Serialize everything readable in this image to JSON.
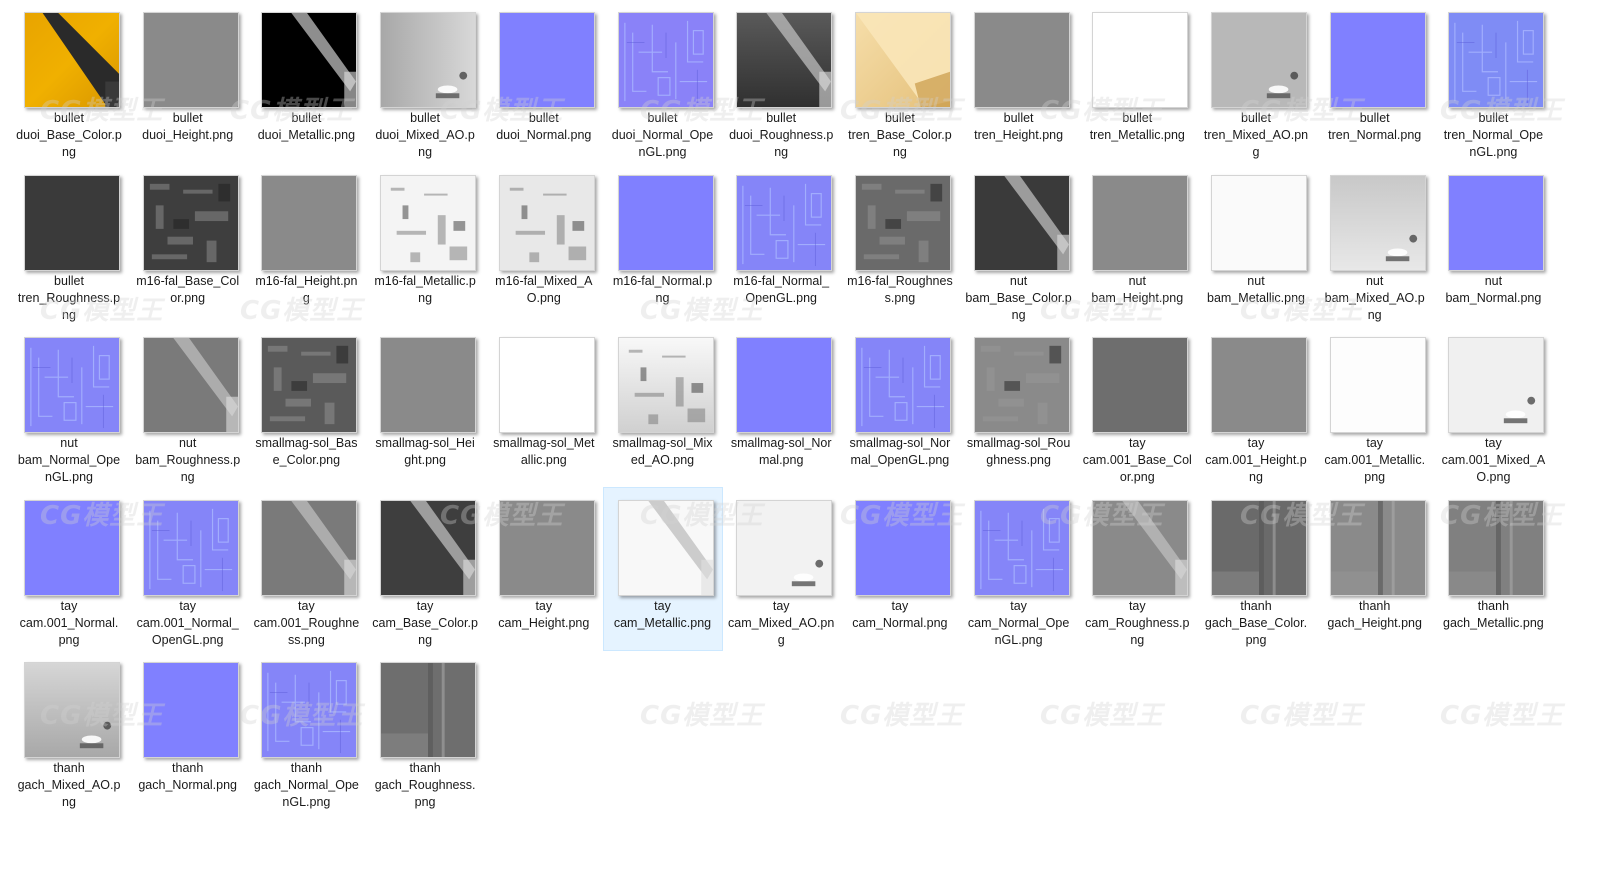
{
  "watermark_text": "CG模型王",
  "selected_file": "tay cam_Metallic.png",
  "files": [
    {
      "label": "bullet\nduoi_Base_Color.p\nng",
      "bg": "linear-gradient(135deg,#e8a400 0%,#f0b000 50%,#d89600 100%)",
      "detail": "dark-wedge"
    },
    {
      "label": "bullet\nduoi_Height.png",
      "bg": "#8a8a8a",
      "detail": "none"
    },
    {
      "label": "bullet\nduoi_Metallic.png",
      "bg": "#000000",
      "detail": "light-wedge"
    },
    {
      "label": "bullet\nduoi_Mixed_AO.p\nng",
      "bg": "linear-gradient(90deg,#a8a8a8,#d8d8d8)",
      "detail": "spot"
    },
    {
      "label": "bullet\nduoi_Normal.png",
      "bg": "#8080ff",
      "detail": "none"
    },
    {
      "label": "bullet\nduoi_Normal_Ope\nnGL.png",
      "bg": "#8a82f8",
      "detail": "normal-lines"
    },
    {
      "label": "bullet\nduoi_Roughness.p\nng",
      "bg": "linear-gradient(180deg,#5a5a5a,#303030)",
      "detail": "light-wedge"
    },
    {
      "label": "bullet\ntren_Base_Color.p\nng",
      "bg": "linear-gradient(135deg,#f6deaa,#e4c07a)",
      "detail": "gold-wedge"
    },
    {
      "label": "bullet\ntren_Height.png",
      "bg": "#8a8a8a",
      "detail": "none"
    },
    {
      "label": "bullet\ntren_Metallic.png",
      "bg": "#ffffff",
      "detail": "none"
    },
    {
      "label": "bullet\ntren_Mixed_AO.pn\ng",
      "bg": "#b8b8b8",
      "detail": "spot"
    },
    {
      "label": "bullet\ntren_Normal.png",
      "bg": "#8080ff",
      "detail": "none"
    },
    {
      "label": "bullet\ntren_Normal_Ope\nnGL.png",
      "bg": "#7f8cf5",
      "detail": "normal-lines"
    },
    {
      "label": "bullet\ntren_Roughness.p\nng",
      "bg": "#3a3a3a",
      "detail": "none"
    },
    {
      "label": "m16-fal_Base_Col\nor.png",
      "bg": "#3e3e3e",
      "detail": "noise-dark"
    },
    {
      "label": "m16-fal_Height.pn\ng",
      "bg": "#8a8a8a",
      "detail": "none"
    },
    {
      "label": "m16-fal_Metallic.p\nng",
      "bg": "#f4f4f4",
      "detail": "noise-light"
    },
    {
      "label": "m16-fal_Mixed_A\nO.png",
      "bg": "#e8e8e8",
      "detail": "noise-light"
    },
    {
      "label": "m16-fal_Normal.p\nng",
      "bg": "#8080ff",
      "detail": "none"
    },
    {
      "label": "m16-fal_Normal_\nOpenGL.png",
      "bg": "#8585f8",
      "detail": "normal-lines"
    },
    {
      "label": "m16-fal_Roughnes\ns.png",
      "bg": "#6a6a6a",
      "detail": "noise-dark"
    },
    {
      "label": "nut\nbam_Base_Color.p\nng",
      "bg": "#3a3a3a",
      "detail": "light-wedge"
    },
    {
      "label": "nut\nbam_Height.png",
      "bg": "#8a8a8a",
      "detail": "none"
    },
    {
      "label": "nut\nbam_Metallic.png",
      "bg": "#fafafa",
      "detail": "none"
    },
    {
      "label": "nut\nbam_Mixed_AO.p\nng",
      "bg": "linear-gradient(180deg,#c8c8c8,#e8e8e8)",
      "detail": "spot"
    },
    {
      "label": "nut\nbam_Normal.png",
      "bg": "#8080ff",
      "detail": "none"
    },
    {
      "label": "nut\nbam_Normal_Ope\nnGL.png",
      "bg": "#8585f8",
      "detail": "normal-lines"
    },
    {
      "label": "nut\nbam_Roughness.p\nng",
      "bg": "#7a7a7a",
      "detail": "light-wedge"
    },
    {
      "label": "smallmag-sol_Bas\ne_Color.png",
      "bg": "#5a5a5a",
      "detail": "noise-dark"
    },
    {
      "label": "smallmag-sol_Hei\nght.png",
      "bg": "#8a8a8a",
      "detail": "none"
    },
    {
      "label": "smallmag-sol_Met\nallic.png",
      "bg": "#ffffff",
      "detail": "none"
    },
    {
      "label": "smallmag-sol_Mix\ned_AO.png",
      "bg": "linear-gradient(180deg,#f8f8f8,#d0d0d0)",
      "detail": "noise-light"
    },
    {
      "label": "smallmag-sol_Nor\nmal.png",
      "bg": "#8080ff",
      "detail": "none"
    },
    {
      "label": "smallmag-sol_Nor\nmal_OpenGL.png",
      "bg": "#8585f8",
      "detail": "normal-lines"
    },
    {
      "label": "smallmag-sol_Rou\nghness.png",
      "bg": "#8a8a8a",
      "detail": "noise-dark"
    },
    {
      "label": "tay\ncam.001_Base_Col\nor.png",
      "bg": "#6e6e6e",
      "detail": "none"
    },
    {
      "label": "tay\ncam.001_Height.p\nng",
      "bg": "#8a8a8a",
      "detail": "none"
    },
    {
      "label": "tay\ncam.001_Metallic.\npng",
      "bg": "#fdfdfd",
      "detail": "none"
    },
    {
      "label": "tay\ncam.001_Mixed_A\nO.png",
      "bg": "#f0f0f0",
      "detail": "spot"
    },
    {
      "label": "tay\ncam.001_Normal.\npng",
      "bg": "#8080ff",
      "detail": "none"
    },
    {
      "label": "tay\ncam.001_Normal_\nOpenGL.png",
      "bg": "#8585f8",
      "detail": "normal-lines"
    },
    {
      "label": "tay\ncam.001_Roughne\nss.png",
      "bg": "#7a7a7a",
      "detail": "light-wedge"
    },
    {
      "label": "tay\ncam_Base_Color.p\nng",
      "bg": "#3e3e3e",
      "detail": "light-wedge"
    },
    {
      "label": "tay\ncam_Height.png",
      "bg": "#8a8a8a",
      "detail": "none"
    },
    {
      "label": "tay\ncam_Metallic.png",
      "bg": "#f8f8f8",
      "detail": "light-wedge"
    },
    {
      "label": "tay\ncam_Mixed_AO.pn\ng",
      "bg": "#f2f2f2",
      "detail": "spot"
    },
    {
      "label": "tay\ncam_Normal.png",
      "bg": "#8080ff",
      "detail": "none"
    },
    {
      "label": "tay\ncam_Normal_Ope\nnGL.png",
      "bg": "#8585f8",
      "detail": "normal-lines"
    },
    {
      "label": "tay\ncam_Roughness.p\nng",
      "bg": "#8a8a8a",
      "detail": "light-wedge"
    },
    {
      "label": "thanh\ngach_Base_Color.\npng",
      "bg": "#6a6a6a",
      "detail": "bars"
    },
    {
      "label": "thanh\ngach_Height.png",
      "bg": "#8a8a8a",
      "detail": "bars"
    },
    {
      "label": "thanh\ngach_Metallic.png",
      "bg": "#808080",
      "detail": "bars"
    },
    {
      "label": "thanh\ngach_Mixed_AO.p\nng",
      "bg": "linear-gradient(180deg,#d6d6d6,#a8a8a8)",
      "detail": "spot"
    },
    {
      "label": "thanh\ngach_Normal.png",
      "bg": "#8080ff",
      "detail": "none"
    },
    {
      "label": "thanh\ngach_Normal_Ope\nnGL.png",
      "bg": "#8585f8",
      "detail": "normal-lines"
    },
    {
      "label": "thanh\ngach_Roughness.\npng",
      "bg": "#6e6e6e",
      "detail": "bars"
    }
  ]
}
